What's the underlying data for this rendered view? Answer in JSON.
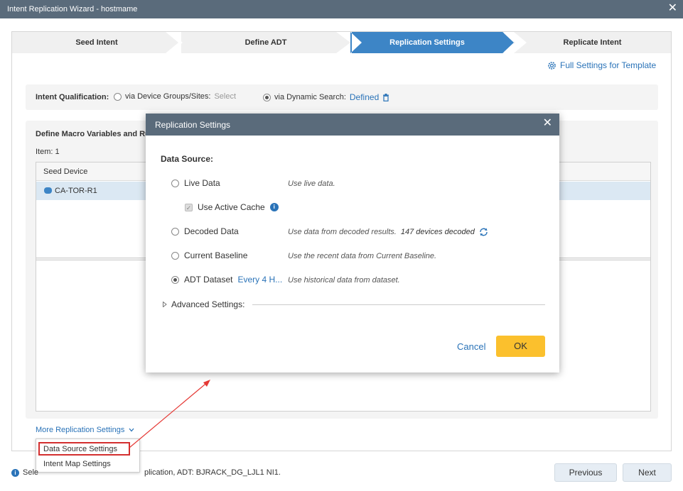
{
  "window": {
    "title": "Intent Replication Wizard - hostmame",
    "close_glyph": "✕"
  },
  "wizard_steps": [
    {
      "label": "Seed Intent",
      "active": false
    },
    {
      "label": "Define ADT",
      "active": false
    },
    {
      "label": "Replication Settings",
      "active": true
    },
    {
      "label": "Replicate Intent",
      "active": false
    }
  ],
  "full_settings_link": {
    "label": "Full Settings for Template",
    "icon": "gear-icon"
  },
  "intent_qualification": {
    "label": "Intent Qualification:",
    "option1": {
      "label": "via Device Groups/Sites:",
      "value": "Select",
      "selected": false
    },
    "option2": {
      "label": "via Dynamic Search:",
      "value": "Defined",
      "selected": true,
      "icon": "trash-icon"
    }
  },
  "macro_section": {
    "title": "Define Macro Variables and Ru",
    "item_count": "Item: 1",
    "column_header": "Seed Device",
    "rows": [
      {
        "device": "CA-TOR-R1"
      }
    ]
  },
  "more_replication": {
    "label": "More Replication Settings",
    "menu_items": [
      "Data Source Settings",
      "Intent Map Settings"
    ],
    "highlighted": "Data Source Settings"
  },
  "status_bar": {
    "prefix": "Sele",
    "suffix": "plication, ADT: BJRACK_DG_LJL1 NI1."
  },
  "footer_buttons": {
    "previous": "Previous",
    "next": "Next"
  },
  "dialog": {
    "title": "Replication Settings",
    "data_source_label": "Data Source:",
    "options": [
      {
        "label": "Live Data",
        "description": "Use live data.",
        "selected": false
      },
      {
        "label": "Decoded Data",
        "description": "Use data from decoded results.",
        "extra": "147 devices decoded",
        "selected": false
      },
      {
        "label": "Current Baseline",
        "description": "Use the recent data from Current Baseline.",
        "selected": false
      },
      {
        "label": "ADT Dataset",
        "link": "Every 4 H...",
        "description": "Use historical data from dataset.",
        "selected": true
      }
    ],
    "active_cache": {
      "label": "Use Active Cache",
      "checked": true,
      "disabled": true
    },
    "advanced_label": "Advanced Settings:",
    "cancel_label": "Cancel",
    "ok_label": "OK"
  },
  "colors": {
    "title_bar": "#5a6b7b",
    "active_step": "#3d85c6",
    "link": "#2a73b8",
    "ok_button": "#fbc02d",
    "highlight_box": "#d32f2f"
  }
}
